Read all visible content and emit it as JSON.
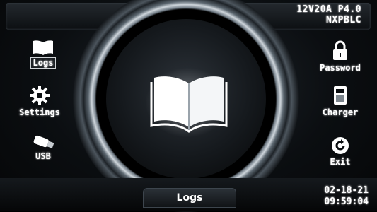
{
  "device": {
    "model": "12V20A P4.0",
    "variant": "NXPBLC"
  },
  "left_menu": [
    {
      "id": "logs",
      "label": "Logs",
      "icon": "book-icon",
      "selected": true
    },
    {
      "id": "settings",
      "label": "Settings",
      "icon": "gear-icon"
    },
    {
      "id": "usb",
      "label": "USB",
      "icon": "usb-icon"
    }
  ],
  "right_menu": [
    {
      "id": "password",
      "label": "Password",
      "icon": "lock-icon"
    },
    {
      "id": "charger",
      "label": "Charger",
      "icon": "charger-icon"
    },
    {
      "id": "exit",
      "label": "Exit",
      "icon": "exit-icon"
    }
  ],
  "center": {
    "icon": "book-icon"
  },
  "status": {
    "title": "Logs",
    "date": "02-18-21",
    "time": "09:59:04"
  }
}
